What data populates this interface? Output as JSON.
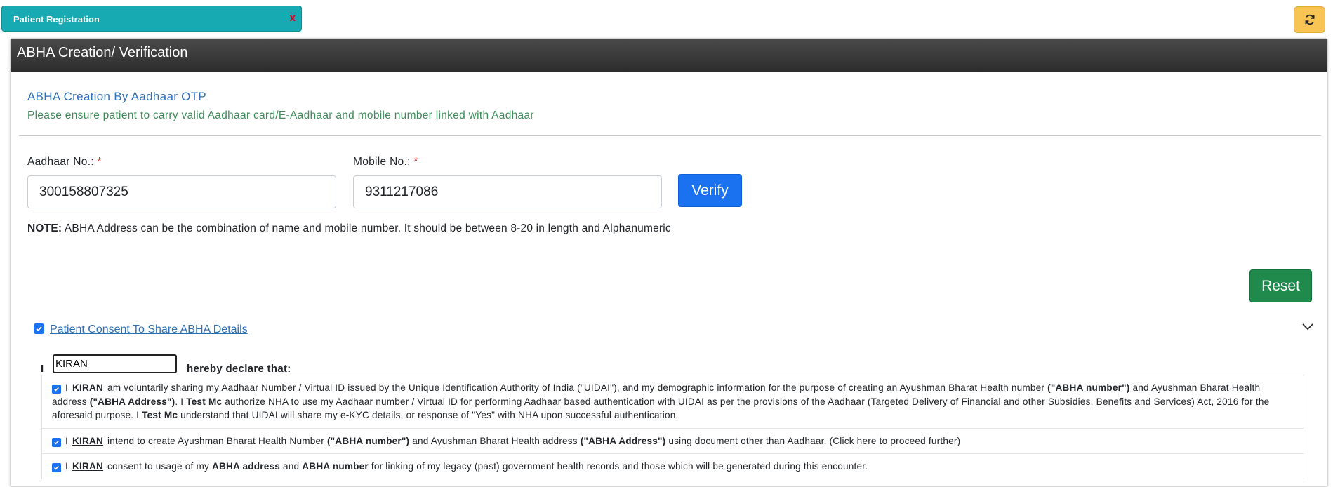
{
  "tab": {
    "title": "Patient Registration",
    "close_label": "x"
  },
  "refresh": {
    "icon": "refresh-icon"
  },
  "panel": {
    "title": "ABHA Creation/ Verification"
  },
  "section": {
    "title": "ABHA Creation By Aadhaar OTP",
    "note": "Please ensure patient to carry valid Aadhaar card/E-Aadhaar and mobile number linked with Aadhaar"
  },
  "form": {
    "aadhaar_label": "Aadhaar No.:",
    "aadhaar_value": "300158807325",
    "mobile_label": "Mobile No.:",
    "mobile_value": "9311217086",
    "required_mark": "*",
    "verify_label": "Verify",
    "note_prefix": "NOTE:",
    "note_text": " ABHA Address can be the combination of name and mobile number. It should be between 8-20 in length and Alphanumeric",
    "reset_label": "Reset"
  },
  "consent": {
    "link_label": "Patient Consent To Share ABHA Details",
    "checked": true,
    "declare_prefix": "I",
    "name_value": "KIRAN",
    "declare_suffix": "hereby declare that:",
    "items": [
      {
        "i": "I",
        "name": "KIRAN",
        "text1": "am voluntarily sharing my Aadhaar Number / Virtual ID issued by the Unique Identification Authority of India (\"UIDAI\"), and my demographic information for the purpose of creating an Ayushman Bharat Health number ",
        "b1": "(\"ABHA number\")",
        "text2": " and Ayushman Bharat Health address ",
        "b2": "(\"ABHA Address\")",
        "text3": ". I ",
        "b3": "Test Mc",
        "text4": " authorize NHA to use my Aadhaar number / Virtual ID for performing Aadhaar based authentication with UIDAI as per the provisions of the Aadhaar (Targeted Delivery of Financial and other Subsidies, Benefits and Services) Act, 2016 for the aforesaid purpose. I ",
        "b4": "Test Mc",
        "text5": " understand that UIDAI will share my e-KYC details, or response of \"Yes\" with NHA upon successful authentication."
      },
      {
        "i": "I",
        "name": "KIRAN",
        "text1": "intend to create Ayushman Bharat Health Number ",
        "b1": "(\"ABHA number\")",
        "text2": " and Ayushman Bharat Health address ",
        "b2": "(\"ABHA Address\")",
        "text3": " using document other than Aadhaar. (Click here to proceed further)"
      },
      {
        "i": "I",
        "name": "KIRAN",
        "text1": "consent to usage of my ",
        "b1": "ABHA address",
        "text2": " and ",
        "b2": "ABHA number",
        "text3": " for linking of my legacy (past) government health records and those which will be generated during this encounter."
      }
    ]
  }
}
